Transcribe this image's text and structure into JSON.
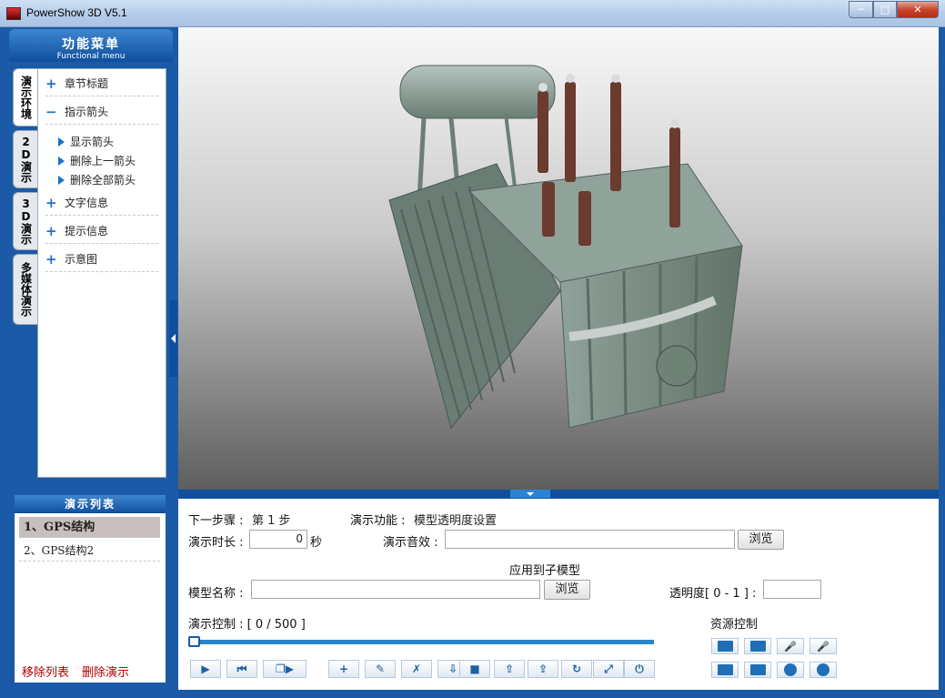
{
  "window": {
    "title": "PowerShow 3D V5.1",
    "min_label": "─",
    "max_label": "□",
    "close_label": "✕"
  },
  "menu": {
    "title_cn": "功能菜单",
    "title_en": "Functional menu",
    "tabs": [
      "演示环境",
      "2D演示",
      "3D演示",
      "多媒体演示"
    ],
    "items": [
      {
        "icon": "+",
        "label": "章节标题"
      },
      {
        "icon": "−",
        "label": "指示箭头"
      },
      {
        "icon": "+",
        "label": "文字信息"
      },
      {
        "icon": "+",
        "label": "提示信息"
      },
      {
        "icon": "+",
        "label": "示意图"
      }
    ],
    "sub_items": [
      "显示箭头",
      "删除上一箭头",
      "删除全部箭头"
    ]
  },
  "demo_list": {
    "title": "演示列表",
    "items": [
      "1、GPS结构",
      "2、GPS结构2"
    ],
    "remove_label": "移除列表",
    "delete_label": "删除演示"
  },
  "controls": {
    "next_step_label": "下一步骤 :",
    "next_step_value": "第 1 步",
    "function_label": "演示功能 :",
    "function_value": "模型透明度设置",
    "duration_label": "演示时长 :",
    "duration_value": "0",
    "duration_unit": "秒",
    "sound_label": "演示音效 :",
    "sound_value": "",
    "browse_label": "浏览",
    "apply_sub_label": "应用到子模型",
    "model_name_label": "模型名称 :",
    "model_name_value": "",
    "transparency_label": "透明度[ 0 - 1 ] :",
    "transparency_value": "",
    "playback_label": "演示控制 : [ 0 / 500 ]",
    "playback_position": 0,
    "resource_label": "资源控制",
    "playback_buttons": [
      "play-icon",
      "first-step-icon",
      "prev-next-icon",
      "last-step-icon",
      "add-step-icon",
      "edit-step-icon",
      "delete-step-icon",
      "import-icon",
      "save-icon",
      "export-icon",
      "upload-icon",
      "refresh-icon",
      "fullscreen-icon",
      "power-icon"
    ],
    "resource_buttons": [
      "image-icon",
      "image-edit-icon",
      "microphone-icon",
      "microphone-edit-icon",
      "video-icon",
      "video-edit-icon",
      "web-icon",
      "web-edit-icon"
    ]
  },
  "colors": {
    "frame_blue": "#1b5aa6",
    "accent_blue": "#1d72c7",
    "danger_red": "#b20000",
    "model_green": "#6f847a"
  }
}
